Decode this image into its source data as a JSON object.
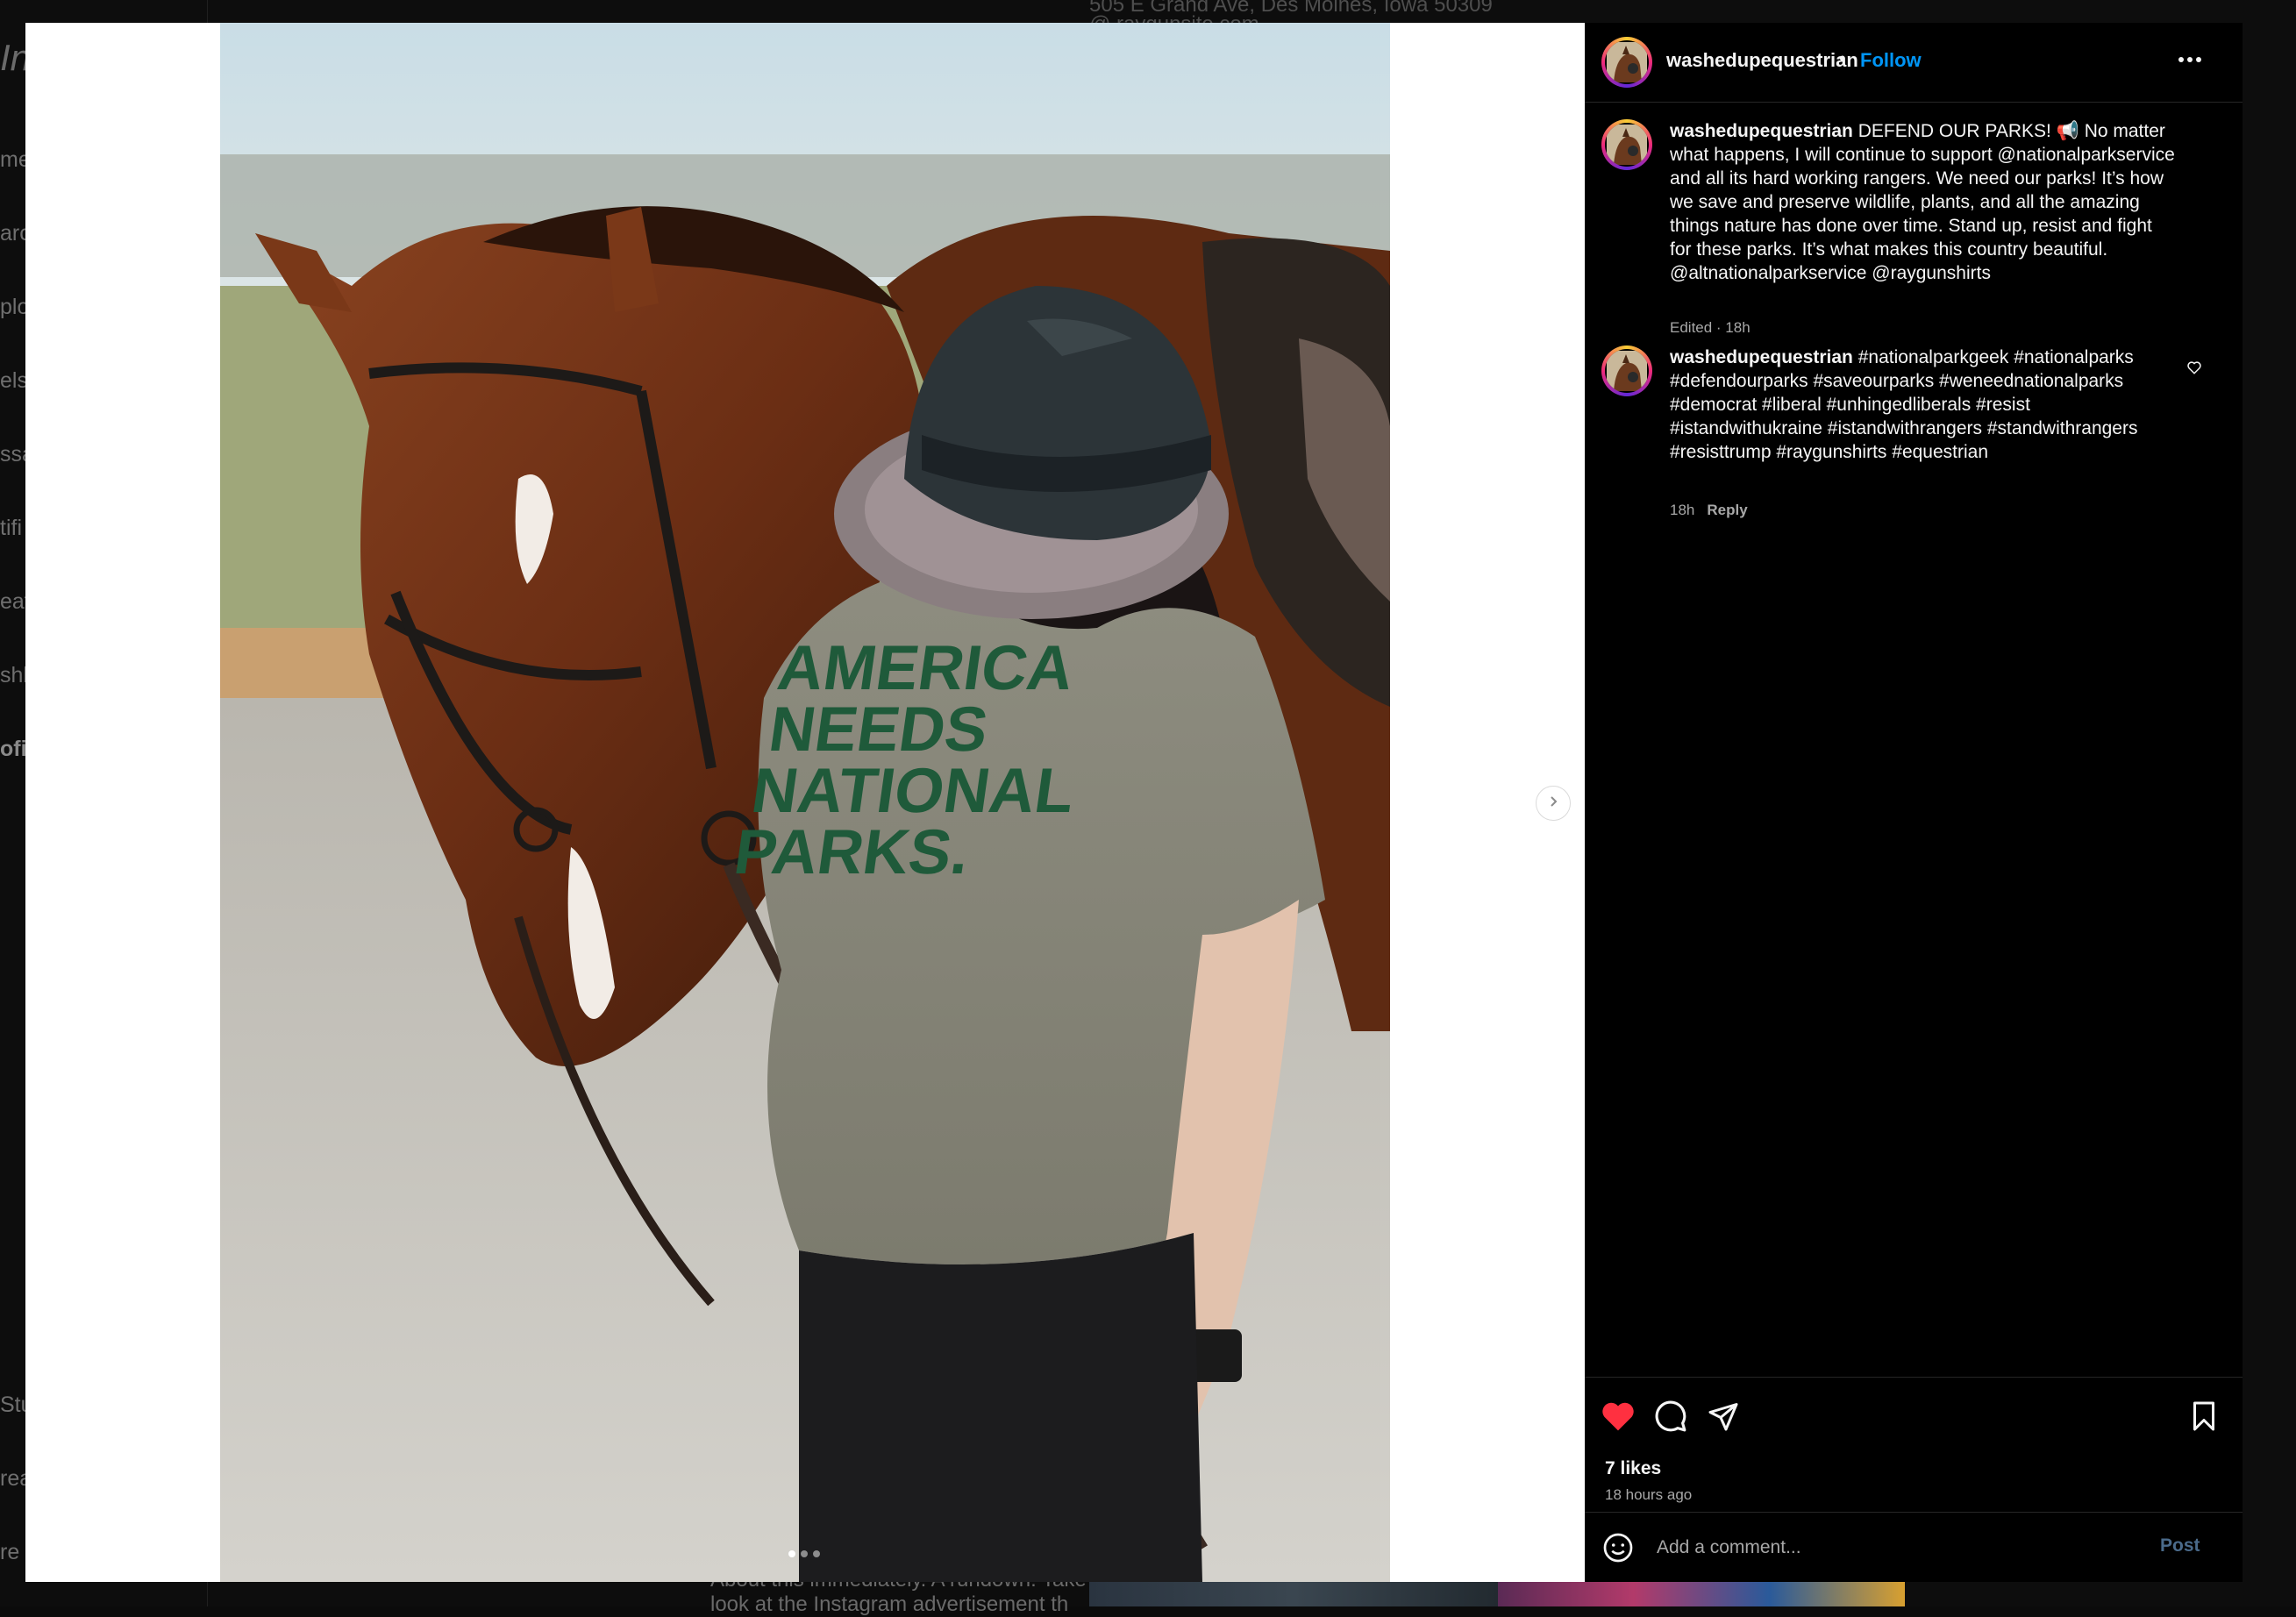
{
  "background": {
    "address_line": "505 E Grand Ave, Des Moines, Iowa 50309",
    "address_line2": "@ raygunsite.com",
    "article_line1": "About this immediately. A rundown: Take",
    "article_line2": "look at the Instagram advertisement th",
    "nav_fragments": [
      "me",
      "arc",
      "plo",
      "els",
      "ssa",
      "tifi",
      "eat",
      "shb",
      "ofil",
      "Stu",
      "rea",
      "re"
    ]
  },
  "post": {
    "username": "washedupequestrian",
    "header_separator": "•",
    "follow_label": "Follow",
    "caption_text": "DEFEND OUR PARKS! 📢 No matter\nwhat happens, I will continue to support @nationalparkservice\nand all its hard working rangers. We need our parks! It’s how\nwe save and preserve wildlife, plants, and all the amazing\nthings nature has done over time. Stand up, resist and fight\nfor these parks. It’s what makes this country beautiful.\n@altnationalparkservice @raygunshirts",
    "caption_meta": "Edited · 18h",
    "comment": {
      "username": "washedupequestrian",
      "text": "#nationalparkgeek #nationalparks\n#defendourparks #saveourparks #weneednationalparks\n#democrat #liberal #unhingedliberals #resist\n#istandwithukraine #istandwithrangers #standwithrangers\n#resisttrump #raygunshirts #equestrian",
      "time": "18h",
      "reply_label": "Reply"
    },
    "likes": "7 likes",
    "time_ago": "18 hours ago",
    "comment_placeholder": "Add a comment...",
    "post_label": "Post",
    "photo_shirt_text": "AMERICA\nNEEDS\nNATIONAL\nPARKS.",
    "carousel": {
      "count": 3,
      "active_index": 0
    },
    "liked": true
  },
  "colors": {
    "accent_blue": "#0095f6",
    "like_red": "#ff3040",
    "muted_text": "#a8a8a8"
  },
  "icons": [
    "heart-icon",
    "comment-icon",
    "share-icon",
    "bookmark-icon",
    "more-icon",
    "chevron-right-icon",
    "emoji-icon"
  ]
}
